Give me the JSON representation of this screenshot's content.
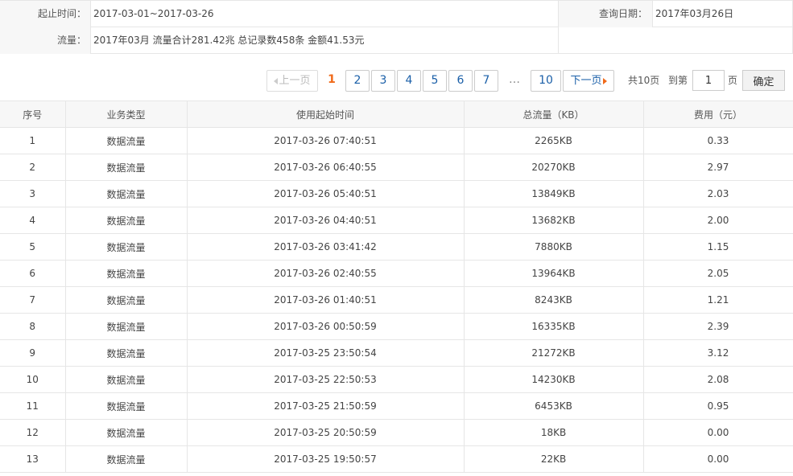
{
  "info": {
    "period_label": "起止时间：",
    "period_value": "2017-03-01~2017-03-26",
    "query_date_label": "查询日期：",
    "query_date_value": "2017年03月26日",
    "traffic_label": "流量：",
    "traffic_value": "2017年03月 流量合计281.42兆 总记录数458条 金额41.53元"
  },
  "pager": {
    "prev_label": "上一页",
    "current": "1",
    "pages": [
      "2",
      "3",
      "4",
      "5",
      "6",
      "7"
    ],
    "ellipsis": "…",
    "last": "10",
    "next_label": "下一页",
    "total_text": "共10页",
    "goto_text": "到第",
    "goto_value": "1",
    "page_unit": "页",
    "confirm_label": "确定"
  },
  "table": {
    "headers": [
      "序号",
      "业务类型",
      "使用起始时间",
      "总流量（KB）",
      "费用（元）"
    ],
    "rows": [
      [
        "1",
        "数据流量",
        "2017-03-26 07:40:51",
        "2265KB",
        "0.33"
      ],
      [
        "2",
        "数据流量",
        "2017-03-26 06:40:55",
        "20270KB",
        "2.97"
      ],
      [
        "3",
        "数据流量",
        "2017-03-26 05:40:51",
        "13849KB",
        "2.03"
      ],
      [
        "4",
        "数据流量",
        "2017-03-26 04:40:51",
        "13682KB",
        "2.00"
      ],
      [
        "5",
        "数据流量",
        "2017-03-26 03:41:42",
        "7880KB",
        "1.15"
      ],
      [
        "6",
        "数据流量",
        "2017-03-26 02:40:55",
        "13964KB",
        "2.05"
      ],
      [
        "7",
        "数据流量",
        "2017-03-26 01:40:51",
        "8243KB",
        "1.21"
      ],
      [
        "8",
        "数据流量",
        "2017-03-26 00:50:59",
        "16335KB",
        "2.39"
      ],
      [
        "9",
        "数据流量",
        "2017-03-25 23:50:54",
        "21272KB",
        "3.12"
      ],
      [
        "10",
        "数据流量",
        "2017-03-25 22:50:53",
        "14230KB",
        "2.08"
      ],
      [
        "11",
        "数据流量",
        "2017-03-25 21:50:59",
        "6453KB",
        "0.95"
      ],
      [
        "12",
        "数据流量",
        "2017-03-25 20:50:59",
        "18KB",
        "0.00"
      ],
      [
        "13",
        "数据流量",
        "2017-03-25 19:50:57",
        "22KB",
        "0.00"
      ]
    ]
  },
  "colors": {
    "current_page": "#f06a1a",
    "link": "#1a5fa8",
    "border": "#e6e6e6",
    "header_bg": "#f7f7f7"
  }
}
